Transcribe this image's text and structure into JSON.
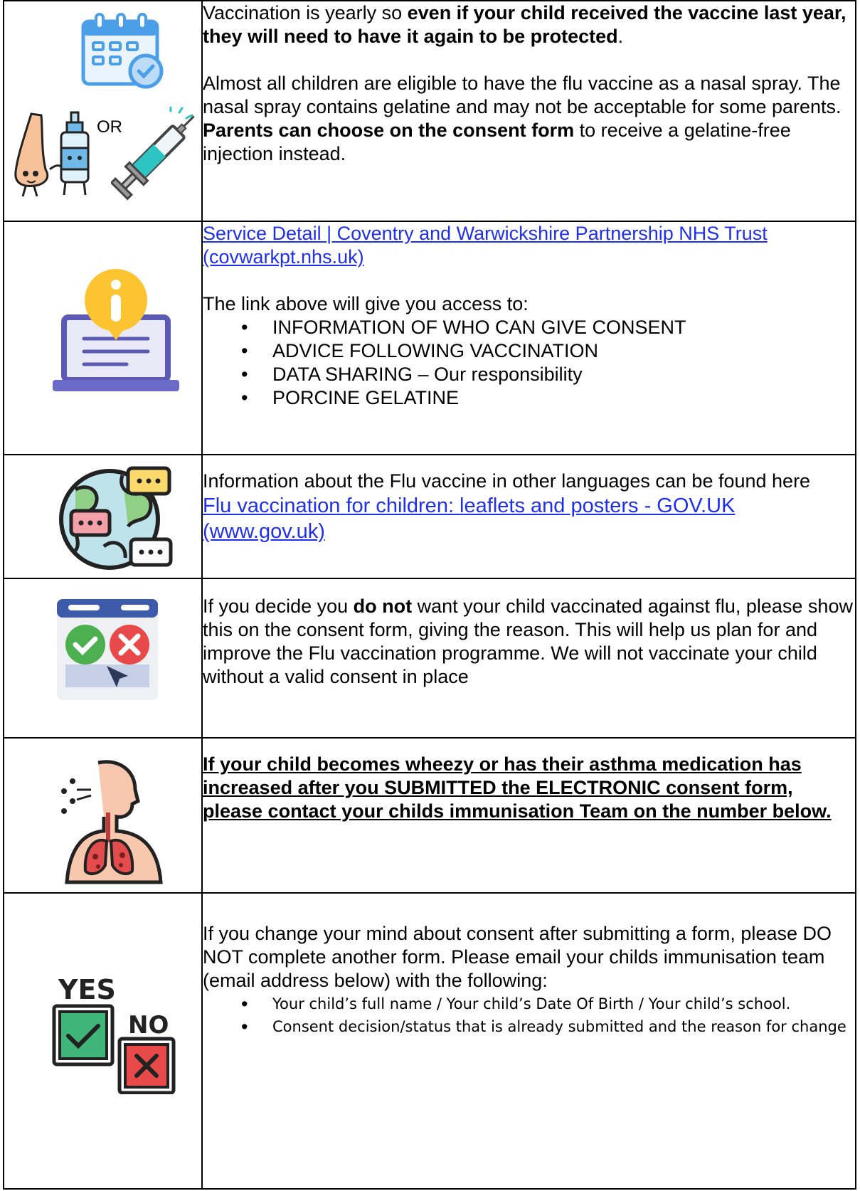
{
  "rows": [
    {
      "icon": "calendar-check-icon",
      "icon2": "nasal-spray-icon",
      "icon3": "syringe-icon",
      "or_label": "OR",
      "p1_start": "Vaccination is yearly so ",
      "p1_bold": "even if your child received the vaccine last year, they will need to have it again to be protected",
      "p1_end": ".",
      "p2_start": "Almost all children are eligible to have the flu vaccine as a nasal spray. The nasal spray contains gelatine and may not be acceptable for some parents. ",
      "p2_bold": "Parents can choose on the consent form",
      "p2_end": " to receive a gelatine-free injection instead."
    },
    {
      "icon": "laptop-info-icon",
      "link": "Service Detail | Coventry and Warwickshire Partnership NHS Trust (covwarkpt.nhs.uk)",
      "intro": "The link above will give you access to:",
      "bullets": [
        "INFORMATION OF WHO CAN GIVE CONSENT",
        "ADVICE FOLLOWING VACCINATION",
        "DATA SHARING – Our responsibility",
        "PORCINE GELATINE"
      ]
    },
    {
      "icon": "globe-languages-icon",
      "text": "Information about the Flu vaccine in other languages can be found here",
      "link": "Flu vaccination for children: leaflets and posters - GOV.UK (www.gov.uk)"
    },
    {
      "icon": "consent-check-cross-icon",
      "start": "If you decide you ",
      "bold": "do not",
      "end": " want your child vaccinated against flu, please show this on the consent form, giving the reason. This will help us plan for and improve the Flu vaccination programme. We will not vaccinate your child without a valid consent in place"
    },
    {
      "icon": "lungs-cough-icon",
      "text": "If your child becomes wheezy or has their asthma medication has increased after you SUBMITTED the ELECTRONIC consent form, please contact your childs immunisation Team on the number below."
    },
    {
      "icon": "yes-no-icon",
      "yes_label": "YES",
      "no_label": "NO",
      "text": "If you change your mind about consent after submitting a form, please DO NOT complete another form. Please email your childs immunisation team (email address below) with the following:",
      "bullets": [
        "Your child’s full name / Your child’s Date Of Birth / Your child’s school.",
        "Consent decision/status that is already submitted and the reason for change"
      ]
    }
  ],
  "colors": {
    "link": "#1f2ff0",
    "calendar_blue": "#4a9fe8",
    "check_green": "#4caf50",
    "cross_red": "#e84a4a"
  }
}
